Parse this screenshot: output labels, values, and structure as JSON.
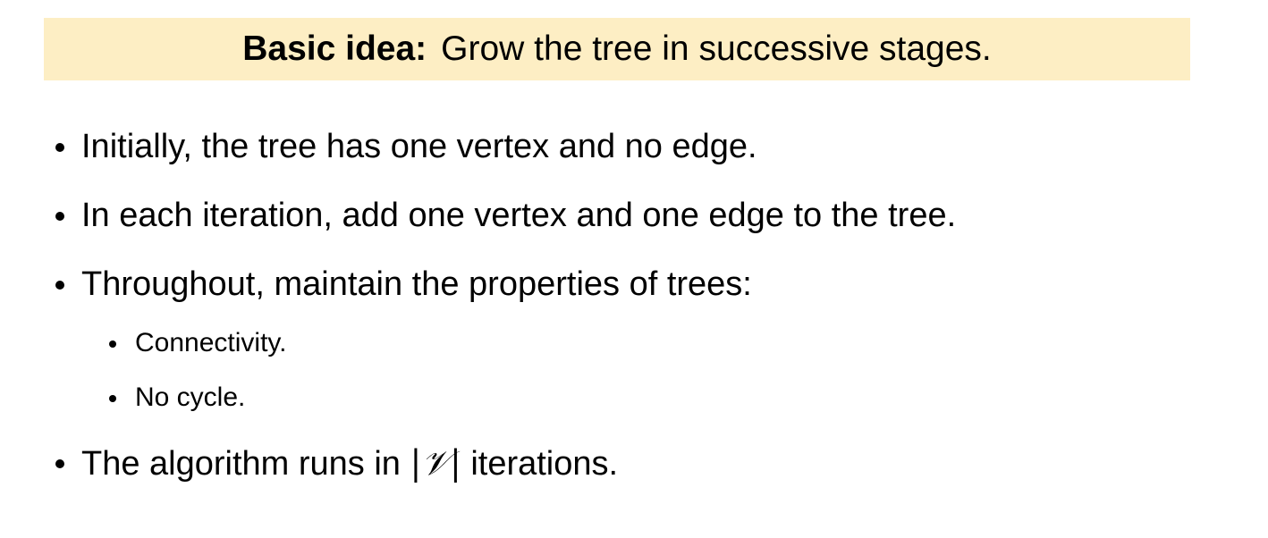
{
  "banner": {
    "lead": "Basic idea:",
    "text": "Grow the tree in successive stages.",
    "background_color": "#fdeec4"
  },
  "bullets": [
    {
      "text": "Initially, the tree has one vertex and no edge."
    },
    {
      "text": "In each iteration, add one vertex and one edge to the tree."
    },
    {
      "text": "Throughout, maintain the properties of trees:",
      "subitems": [
        {
          "text": "Connectivity."
        },
        {
          "text": "No cycle."
        }
      ]
    },
    {
      "text_before": "The algorithm runs in ",
      "math": "|𝒱|",
      "text_after": " iterations."
    }
  ]
}
